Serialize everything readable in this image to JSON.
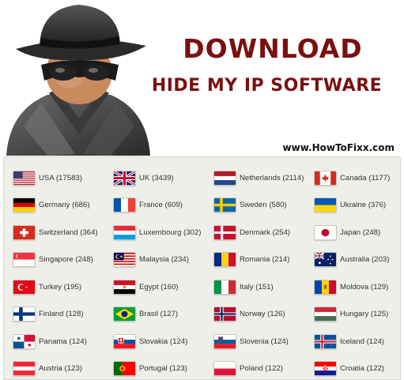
{
  "header": {
    "title_line1": "DOWNLOAD",
    "title_line2": "HIDE MY IP SOFTWARE",
    "website": "www.HowToFixx.com"
  },
  "colors": {
    "title": "#7a1010",
    "panel_bg": "#efefe9"
  },
  "countries": [
    {
      "label": "USA (17583)",
      "flag": "usa-flag"
    },
    {
      "label": "UK (3439)",
      "flag": "uk-flag"
    },
    {
      "label": "Netherlands (2114)",
      "flag": "netherlands-flag"
    },
    {
      "label": "Canada (1177)",
      "flag": "canada-flag"
    },
    {
      "label": "Germany (686)",
      "flag": "germany-flag"
    },
    {
      "label": "France (609)",
      "flag": "france-flag"
    },
    {
      "label": "Sweden (580)",
      "flag": "sweden-flag"
    },
    {
      "label": "Ukraine (376)",
      "flag": "ukraine-flag"
    },
    {
      "label": "Switzerland (364)",
      "flag": "switzerland-flag"
    },
    {
      "label": "Luxembourg (302)",
      "flag": "luxembourg-flag"
    },
    {
      "label": "Denmark (254)",
      "flag": "denmark-flag"
    },
    {
      "label": "Japan (248)",
      "flag": "japan-flag"
    },
    {
      "label": "Singapore (248)",
      "flag": "singapore-flag"
    },
    {
      "label": "Malaysia (234)",
      "flag": "malaysia-flag"
    },
    {
      "label": "Romania (214)",
      "flag": "romania-flag"
    },
    {
      "label": "Australia (203)",
      "flag": "australia-flag"
    },
    {
      "label": "Turkey (195)",
      "flag": "turkey-flag"
    },
    {
      "label": "Egypt (160)",
      "flag": "egypt-flag"
    },
    {
      "label": "Italy (151)",
      "flag": "italy-flag"
    },
    {
      "label": "Moldova (129)",
      "flag": "moldova-flag"
    },
    {
      "label": "Finland (128)",
      "flag": "finland-flag"
    },
    {
      "label": "Brasil (127)",
      "flag": "brasil-flag"
    },
    {
      "label": "Norway (126)",
      "flag": "norway-flag"
    },
    {
      "label": "Hungary (125)",
      "flag": "hungary-flag"
    },
    {
      "label": "Panama (124)",
      "flag": "panama-flag"
    },
    {
      "label": "Slovakia (124)",
      "flag": "slovakia-flag"
    },
    {
      "label": "Slovenia (124)",
      "flag": "slovenia-flag"
    },
    {
      "label": "Iceland (124)",
      "flag": "iceland-flag"
    },
    {
      "label": "Austria (123)",
      "flag": "austria-flag"
    },
    {
      "label": "Portugal (123)",
      "flag": "portugal-flag"
    },
    {
      "label": "Poland (122)",
      "flag": "poland-flag"
    },
    {
      "label": "Croatia (122)",
      "flag": "croatia-flag"
    }
  ]
}
